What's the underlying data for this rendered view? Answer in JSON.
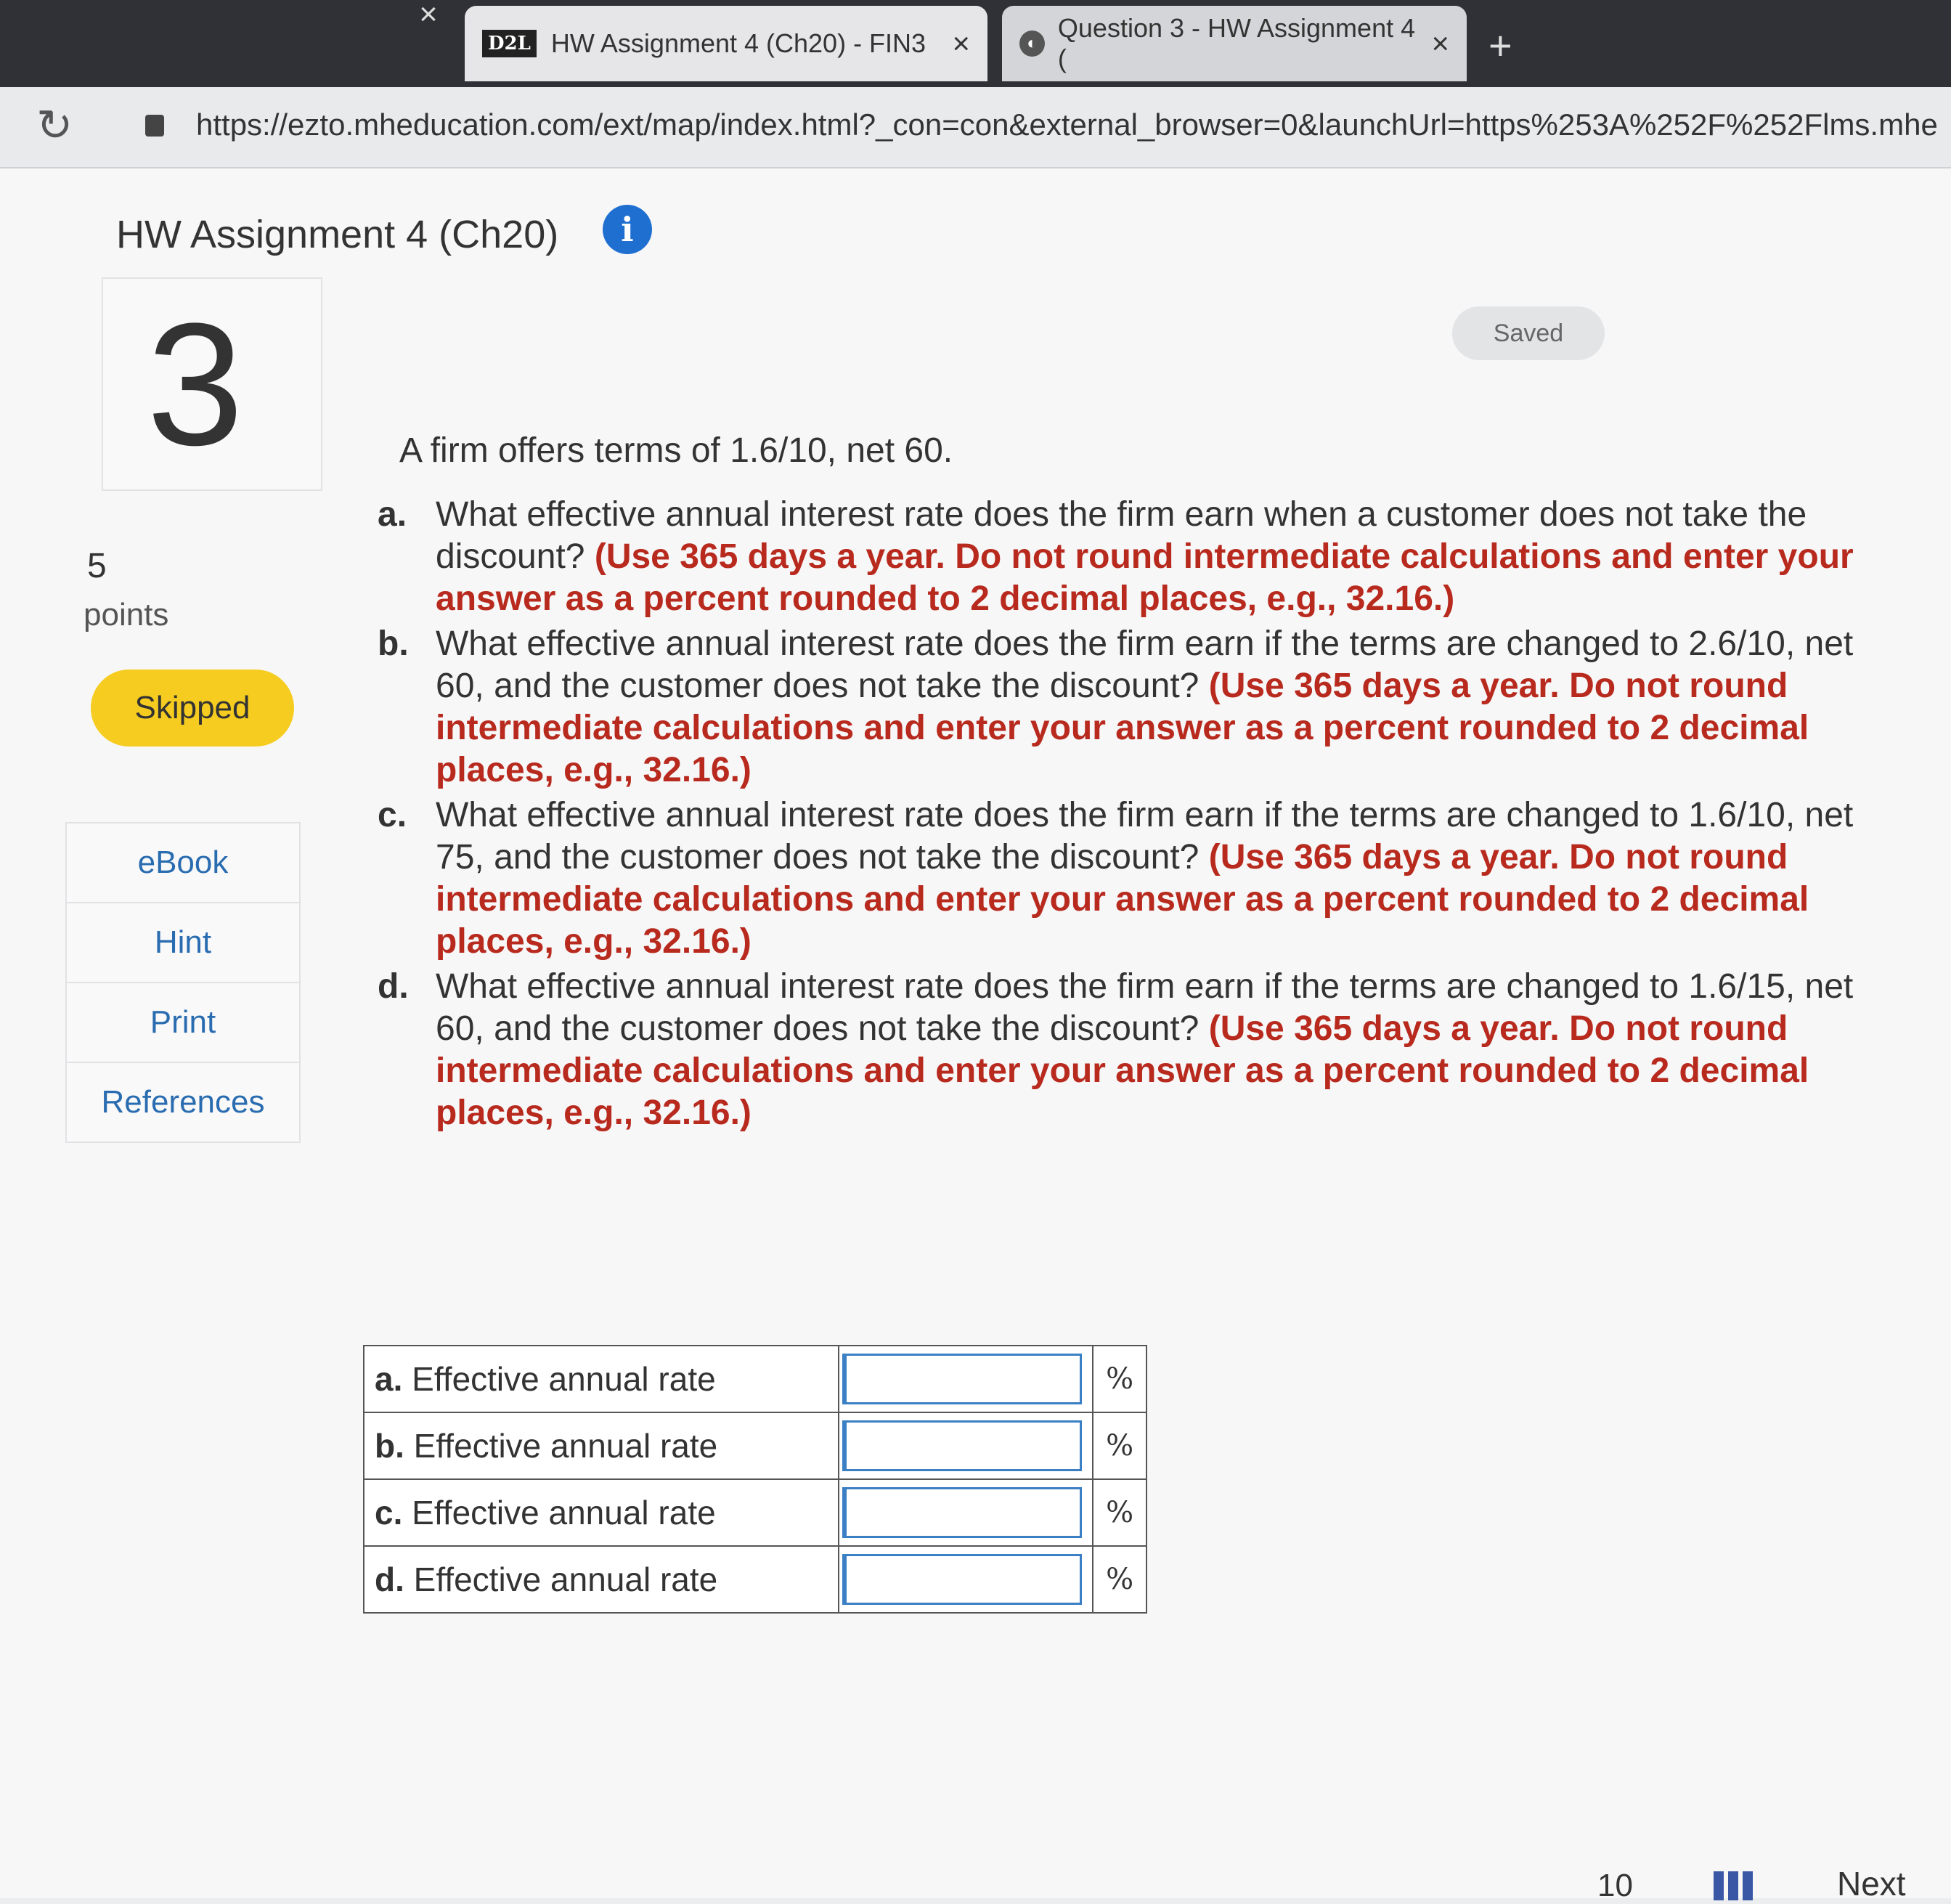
{
  "browser": {
    "tabs": [
      {
        "label": "HW Assignment 4 (Ch20) - FIN3",
        "logo": "D2L",
        "close": "×"
      },
      {
        "label": "Question 3 - HW Assignment 4 (",
        "close": "×"
      }
    ],
    "prev_tab_close": "×",
    "new_tab": "+",
    "url": "https://ezto.mheducation.com/ext/map/index.html?_con=con&external_browser=0&launchUrl=https%253A%252F%252Flms.mheducatio"
  },
  "header": {
    "title": "HW Assignment 4 (Ch20)",
    "info": "i",
    "saved": "Saved"
  },
  "question": {
    "number": "3",
    "points_value": "5",
    "points_label": "points",
    "status": "Skipped",
    "intro": "A firm offers terms of 1.6/10, net 60.",
    "parts": [
      {
        "letter": "a.",
        "text": "What effective annual interest rate does the firm earn when a customer does not take the discount?",
        "instruction": "(Use 365 days a year. Do not round intermediate calculations and enter your answer as a percent rounded to 2 decimal places, e.g., 32.16.)"
      },
      {
        "letter": "b.",
        "text": "What effective annual interest rate does the firm earn if the terms are changed to 2.6/10, net 60, and the customer does not take the discount?",
        "instruction": "(Use 365 days a year. Do not round intermediate calculations and enter your answer as a percent rounded to 2 decimal places, e.g., 32.16.)"
      },
      {
        "letter": "c.",
        "text": "What effective annual interest rate does the firm earn if the terms are changed to 1.6/10, net 75, and the customer does not take the discount?",
        "instruction": "(Use 365 days a year. Do not round intermediate calculations and enter your answer as a percent rounded to 2 decimal places, e.g., 32.16.)"
      },
      {
        "letter": "d.",
        "text": "What effective annual interest rate does the firm earn if the terms are changed to 1.6/15, net 60, and the customer does not take the discount?",
        "instruction": "(Use 365 days a year. Do not round intermediate calculations and enter your answer as a percent rounded to 2 decimal places, e.g., 32.16.)"
      }
    ]
  },
  "sidebar": {
    "links": [
      "eBook",
      "Hint",
      "Print",
      "References"
    ]
  },
  "answers": {
    "rows": [
      {
        "letter": "a.",
        "label": "Effective annual rate",
        "value": "",
        "unit": "%"
      },
      {
        "letter": "b.",
        "label": "Effective annual rate",
        "value": "",
        "unit": "%"
      },
      {
        "letter": "c.",
        "label": "Effective annual rate",
        "value": "",
        "unit": "%"
      },
      {
        "letter": "d.",
        "label": "Effective annual rate",
        "value": "",
        "unit": "%"
      }
    ]
  },
  "footer": {
    "page_indicator": "10",
    "next_label": "Next"
  },
  "colors": {
    "accent_blue": "#1f6fd1",
    "instruction_red": "#b82a1e",
    "skipped_yellow": "#f5cc1f"
  }
}
